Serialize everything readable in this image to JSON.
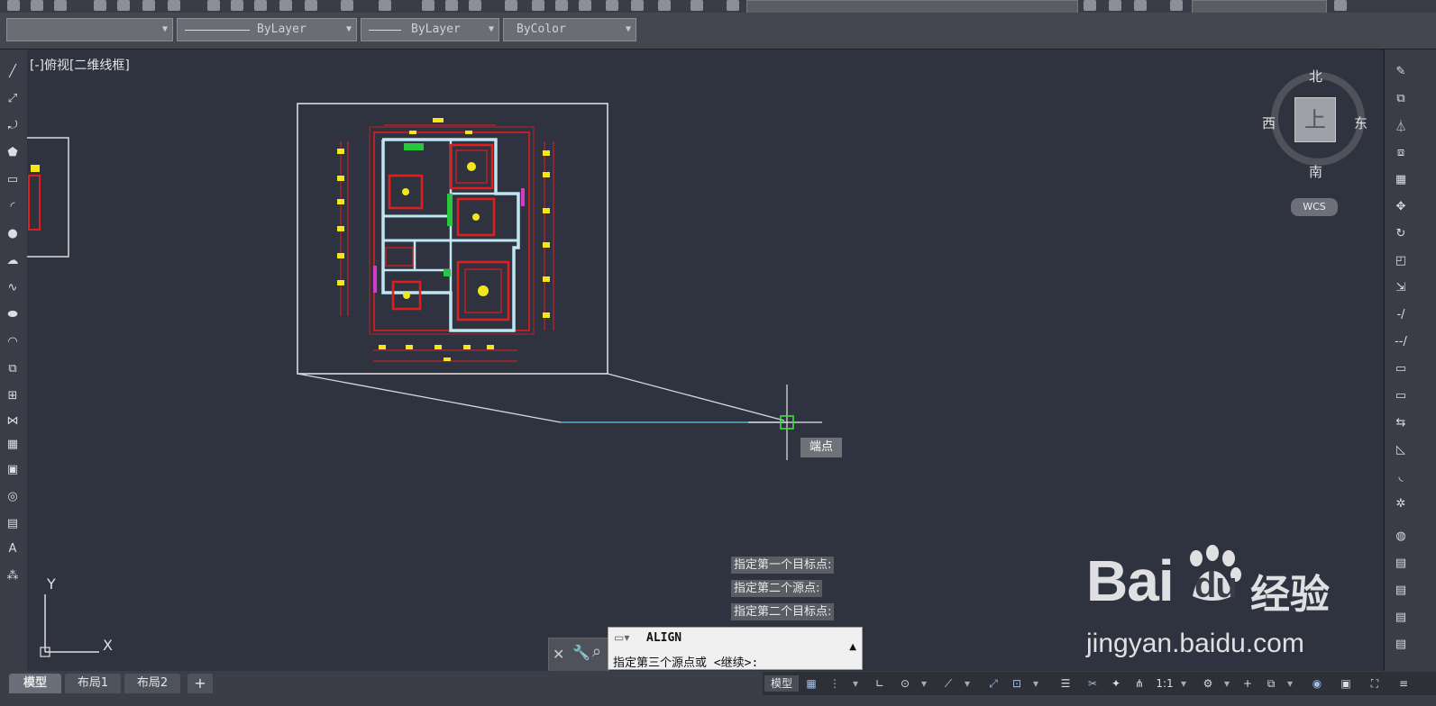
{
  "properties": {
    "layer_value": "",
    "linetype": "ByLayer",
    "lineweight": "ByLayer",
    "color": "ByColor"
  },
  "viewport": {
    "label": "[-]俯视[二维线框]"
  },
  "viewcube": {
    "face": "上",
    "north": "北",
    "south": "南",
    "east": "东",
    "west": "西",
    "wcs": "WCS"
  },
  "snap_tooltip": "端点",
  "command_history": [
    "指定第一个目标点:",
    "指定第二个源点:",
    "指定第二个目标点:"
  ],
  "command_line": {
    "name": "ALIGN",
    "prompt": "指定第三个源点或 <继续>:"
  },
  "layout_tabs": [
    "模型",
    "布局1",
    "布局2"
  ],
  "add_tab": "+",
  "status": {
    "model": "模型",
    "scale": "1:1"
  },
  "ucs": {
    "x": "X",
    "y": "Y"
  },
  "watermark": {
    "brand_left": "Bai",
    "brand_right": "du",
    "brand_cn": "经验",
    "url": "jingyan.baidu.com"
  },
  "colors": {
    "canvas": "#2f3340",
    "drawing_red": "#e01e1e",
    "drawing_yellow": "#f5e51b",
    "drawing_cyan": "#bfe6f2",
    "align_line": "#4fb6c9",
    "snap_marker": "#3ce03c"
  }
}
